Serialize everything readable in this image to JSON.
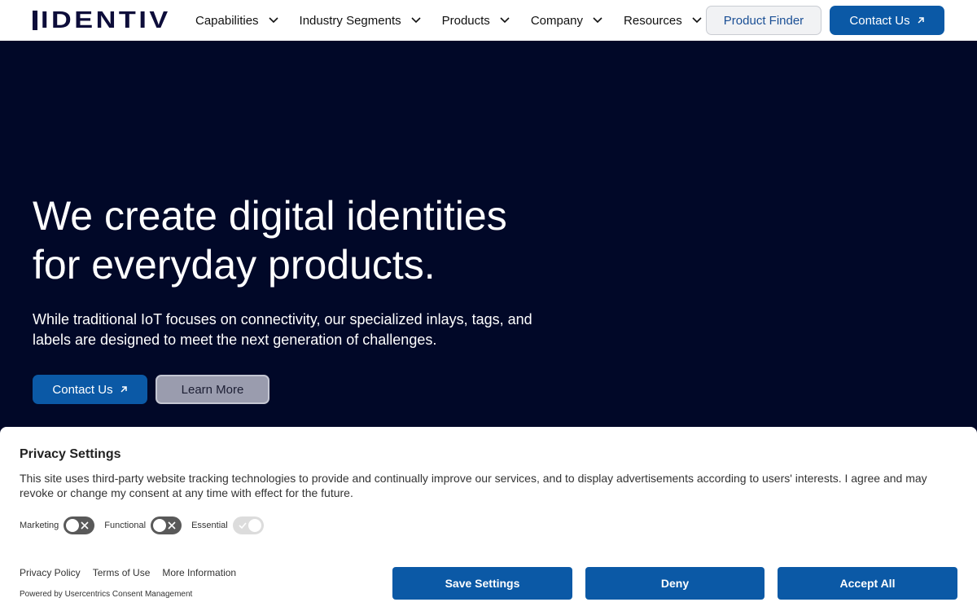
{
  "header": {
    "logo_text": "IDENTIV",
    "nav": [
      {
        "label": "Capabilities"
      },
      {
        "label": "Industry Segments"
      },
      {
        "label": "Products"
      },
      {
        "label": "Company"
      },
      {
        "label": "Resources"
      }
    ],
    "product_finder_label": "Product Finder",
    "contact_label": "Contact Us"
  },
  "hero": {
    "title_line1": "We create digital identities",
    "title_line2": "for everyday products.",
    "subtitle": "While traditional IoT focuses on connectivity, our specialized inlays, tags, and labels are designed to meet the next generation of challenges.",
    "contact_label": "Contact Us",
    "learn_more_label": "Learn More"
  },
  "consent": {
    "title": "Privacy Settings",
    "text": "This site uses third-party website tracking technologies to provide and continually improve our services, and to display advertisements according to users' interests. I agree and may revoke or change my consent at any time with effect for the future.",
    "toggles": [
      {
        "label": "Marketing",
        "state": "off"
      },
      {
        "label": "Functional",
        "state": "off"
      },
      {
        "label": "Essential",
        "state": "on-disabled"
      }
    ],
    "links": [
      "Privacy Policy",
      "Terms of Use",
      "More Information"
    ],
    "powered_by": "Powered by Usercentrics Consent Management",
    "save_label": "Save Settings",
    "deny_label": "Deny",
    "accept_label": "Accept All"
  },
  "colors": {
    "hero_bg": "#010828",
    "primary_blue": "#0b59a6",
    "logo": "#0d0d3a"
  }
}
